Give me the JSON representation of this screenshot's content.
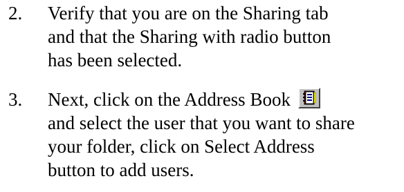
{
  "steps": [
    {
      "number": "2.",
      "lines": [
        "Verify that you are on the Sharing tab",
        "and that the Sharing with radio button",
        "has been selected."
      ]
    },
    {
      "number": "3.",
      "line1_before_icon": "Next, click on the Address Book",
      "icon": "address-book-icon",
      "lines_after": [
        "and select the user that you want to share",
        "your folder, click on Select Address",
        "button to add users."
      ]
    }
  ]
}
